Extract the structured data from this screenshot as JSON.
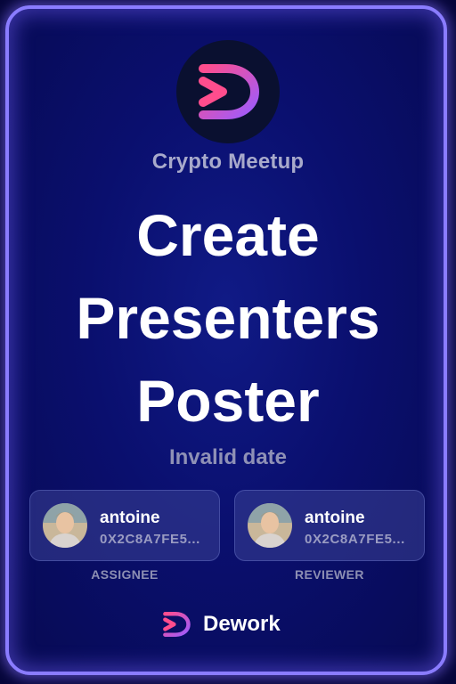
{
  "card": {
    "organization": "Crypto Meetup",
    "title": "Create Presenters Poster",
    "date": "Invalid date"
  },
  "assignee": {
    "name": "antoine",
    "address": "0X2C8A7FE5...",
    "role": "ASSIGNEE"
  },
  "reviewer": {
    "name": "antoine",
    "address": "0X2C8A7FE5...",
    "role": "REVIEWER"
  },
  "brand": {
    "name": "Dework"
  },
  "colors": {
    "border": "#8a7cff",
    "background": "#0a0f6e",
    "logo_pink": "#ff4d8d",
    "logo_purple": "#9b5cff"
  }
}
